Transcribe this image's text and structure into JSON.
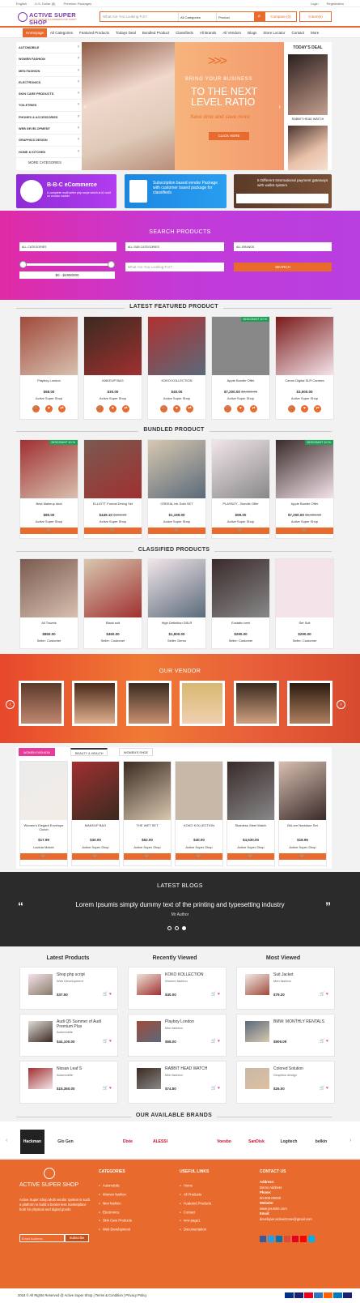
{
  "topbar": {
    "lang": "English",
    "currency": "U.S. Dollar ($)",
    "premium": "Premium Packages",
    "login": "Login",
    "register": "Registration"
  },
  "header": {
    "logo": "ACTIVE SUPER SHOP",
    "tagline": "A MULTI VENDOR E-COMMERCE PHP SCRIPT",
    "search_placeholder": "What Are You Looking For?",
    "cat": "All Categories",
    "product": "Product",
    "compare": "Compare (0)",
    "cart": "0 item(s)"
  },
  "nav": [
    "Homepage",
    "All Categories",
    "Featured Products",
    "Todays Deal",
    "Bundled Product",
    "Classifieds",
    "All Brands",
    "All Vendors",
    "Blogs",
    "Store Locator",
    "Contact",
    "More"
  ],
  "categories": [
    "AUTOMOBILE",
    "WOMEN FASHION",
    "MEN FASHION",
    "ELECTRONICS",
    "SKIN CARE PRODUCTS",
    "TOILETRIES",
    "PHONES & ACCESSORIES",
    "WEB DEVELOPMENT",
    "GRAPHICS DESIGN",
    "HOME & KITCHEN"
  ],
  "more_categories": "MORE CATEGORIES",
  "hero": {
    "l1": "BRING YOUR BUSINESS",
    "l2a": "TO THE NEXT",
    "l2b": "LEVEL RATIO",
    "l3": "Save time and save more",
    "btn": "CLICK HERE"
  },
  "today": {
    "title": "TODAY'S DEAL",
    "item": "RABBIT HEAD WATCH"
  },
  "banners": {
    "b1": "B-B-C eCommerce",
    "b1s": "A complete multi seller php script which is #1 sold on envato market",
    "b2": "Subscription based vendor Package with customer based package for classifieds",
    "b3": "5 Different International payment gateways with wallet system"
  },
  "search": {
    "title": "SEARCH PRODUCTS",
    "dd1": "ALL CATEGORIES",
    "dd2": "ALL SUB CATEGORIES",
    "dd3": "ALL BRANDS",
    "range": "$0 - $4890000",
    "placeholder": "What Are You Looking For?",
    "btn": "SEARCH"
  },
  "featured": {
    "title": "LATEST FEATURED PRODUCT",
    "items": [
      {
        "name": "Playboy London",
        "price": "$68.00",
        "old": "",
        "shop": "Active Super Shop",
        "badge": ""
      },
      {
        "name": "MAKEUP BAG",
        "price": "$30.00",
        "old": "",
        "shop": "Active Super Shop",
        "badge": ""
      },
      {
        "name": "KOKO KOLLECTION",
        "price": "$40.00",
        "old": "",
        "shop": "Active Super Shop",
        "badge": ""
      },
      {
        "name": "Apple Bundle Offer",
        "price": "$7,200.00",
        "old": "$8,000.00",
        "shop": "Active Super Shop",
        "badge": "DISCOUNT 10 %"
      },
      {
        "name": "Canon Digital SLR Camera",
        "price": "$3,500.00",
        "old": "",
        "shop": "Active Super Shop",
        "badge": ""
      }
    ]
  },
  "bundled": {
    "title": "BUNDLED PRODUCT",
    "items": [
      {
        "name": "Best Makeup deal",
        "price": "$80.00",
        "old": "",
        "shop": "Active Super Shop",
        "badge": "DISCOUNT 10 %"
      },
      {
        "name": "ELLIOTT Formal Dining Set",
        "price": "$449.10",
        "old": "$499.00",
        "shop": "Active Super Shop",
        "badge": ""
      },
      {
        "name": "CREEAL ink Sofa SET",
        "price": "$1,199.00",
        "old": "",
        "shop": "Active Super Shop",
        "badge": ""
      },
      {
        "name": "PLAYBOY - Bundle Offer",
        "price": "$99.00",
        "old": "",
        "shop": "Active Super Shop",
        "badge": ""
      },
      {
        "name": "Apple Bundle Offer",
        "price": "$7,200.00",
        "old": "$8,000.00",
        "shop": "Active Super Shop",
        "badge": "DISCOUNT 10 %"
      }
    ]
  },
  "classified": {
    "title": "CLASSIFIED PRODUCTS",
    "items": [
      {
        "name": "All Travels",
        "price": "$850.00",
        "shop": "Seller: Customer"
      },
      {
        "name": "Black suit",
        "price": "$460.00",
        "shop": "Seller: Customer"
      },
      {
        "name": "High Definition DSLR",
        "price": "$1,800.00",
        "shop": "Seller: Demo"
      },
      {
        "name": "Ecstatic heel",
        "price": "$290.00",
        "shop": "Seller: Customer"
      },
      {
        "name": "Set Suit",
        "price": "$290.00",
        "shop": "Seller: Customer"
      }
    ]
  },
  "vendor": {
    "title": "OUR VENDOR"
  },
  "tabs": {
    "t1": "WOMEN FASHION",
    "t2": "BEAUTY & HEALTH",
    "t3": "WOMEN'S SHOE",
    "items": [
      {
        "name": "Women's Elegant Envelope Clutch",
        "price": "$17.99",
        "shop": "Lavinia Mckee"
      },
      {
        "name": "MAKEUP BAG",
        "price": "$30.00",
        "shop": "Active Super Shop"
      },
      {
        "name": "THE WET SET",
        "price": "$62.00",
        "shop": "Active Super Shop"
      },
      {
        "name": "KOKO KOLLECTION",
        "price": "$40.00",
        "shop": "Active Super Shop"
      },
      {
        "name": "Stainless Steel Watch",
        "price": "$4,530.00",
        "shop": "Active Super Shop"
      },
      {
        "name": "BriLore Necklace Set",
        "price": "$18.95",
        "shop": "Active Super Shop"
      }
    ]
  },
  "blogs": {
    "title": "LATEST BLOGS",
    "quote": "Lorem Ipsumis simply dummy text of the printing and typesetting industry",
    "author": "Mr Author"
  },
  "cols": {
    "c1": "Latest Products",
    "c2": "Recently Viewed",
    "c3": "Most Viewed",
    "latest": [
      {
        "name": "Shop php script",
        "cat": "Web Development",
        "price": "$37.50"
      },
      {
        "name": "Audi Q5 Summer of Audi Premium Plus",
        "cat": "Automobile",
        "price": "$44,100.00"
      },
      {
        "name": "Nissan Leaf S",
        "cat": "Automobile",
        "price": "$15,360.00"
      }
    ],
    "recent": [
      {
        "name": "KOKO KOLLECTION",
        "cat": "Women fashion",
        "price": "$40.00"
      },
      {
        "name": "Playboy London",
        "cat": "Men fashion",
        "price": "$68.00"
      },
      {
        "name": "RABBIT HEAD WATCH",
        "cat": "Men fashion",
        "price": "$74.80"
      }
    ],
    "most": [
      {
        "name": "Suit Jacket",
        "cat": "Men fashion",
        "price": "$79.20"
      },
      {
        "name": "BMW: MONTHLY RENTALS",
        "cat": "",
        "price": "$909.09"
      },
      {
        "name": "Colored Solution",
        "cat": "Graphics design",
        "price": "$26.00"
      }
    ]
  },
  "brands": {
    "title": "OUR AVAILABLE BRANDS",
    "list": [
      "Hackman",
      "Glo Gen",
      "",
      "Dixie",
      "ALESSI",
      "",
      "Voesbo",
      "SanDisk",
      "Logitech",
      "belkin"
    ]
  },
  "footer": {
    "logo": "ACTIVE SUPER SHOP",
    "about": "Active Super Shop Multi vendor system is such a platform to build a border less marketplace both for physical and digital goods.",
    "email_ph": "Email Address",
    "subscribe": "Subscribe",
    "h1": "CATEGORIES",
    "cats": [
      "Automobile",
      "Women fashion",
      "Men fashion",
      "Electronics",
      "Skin Care Products",
      "Web Development"
    ],
    "h2": "USEFUL LINKS",
    "links": [
      "Home",
      "All Products",
      "Featured Products",
      "Contact",
      "new page1",
      "Documentation"
    ],
    "h3": "CONTACT US",
    "addr_l": "Address:",
    "addr": "Demo Address",
    "phone_l": "Phone:",
    "phone": "00-000-00000",
    "web_l": "Website:",
    "web": "www.yoursite.com",
    "email_l": "Email:",
    "email": "developer.activeitzone@gmail.com",
    "copy": "2018 © All Rights Reserved @ Active Super Shop | Terms & Condition | Privacy Policy"
  }
}
